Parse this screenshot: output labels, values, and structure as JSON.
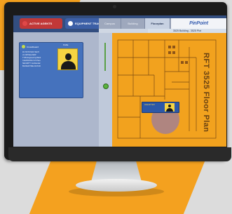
{
  "toolbar": {
    "active_agents": "ACTIVE AGENTS",
    "equipment_tracking": "EQUIPMENT TRACKING"
  },
  "tabs": [
    "Campus",
    "Building",
    "Floorplan"
  ],
  "brand": "PinPoint",
  "agent_card": {
    "header": "CrowdGuard",
    "badge_label": "Profile",
    "lines": [
      "FN HOTSTUFF TECH",
      "LN ORTEGA  MRP",
      "TYPE Engineering Black",
      "CLEARANCE CL5 Pass",
      "SECURITY Confidential",
      "BUFFER TIME 20:45:00"
    ]
  },
  "map": {
    "building_label": "3525 Building - 3525 Plot",
    "floor_title": "RFT 3525 Floor Plan",
    "pin_label": "Hotstuff Tech"
  },
  "colors": {
    "orange": "#f4a11f",
    "topbar": "#334e80",
    "agents_button": "#c13838",
    "equipment_button": "#3c5fa6"
  }
}
